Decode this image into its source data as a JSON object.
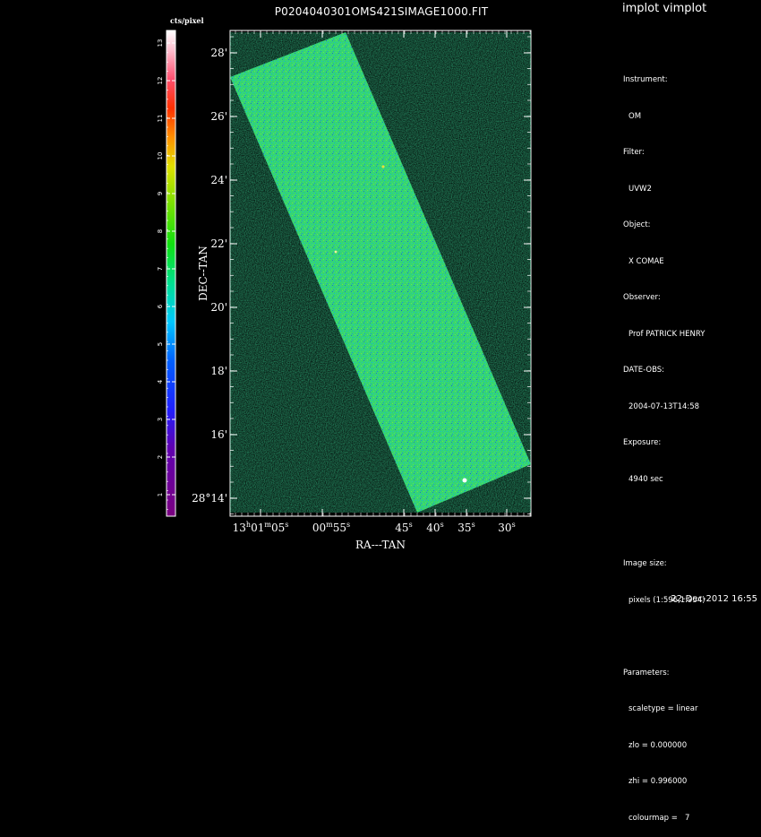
{
  "header": {
    "app_title": "implot vimplot",
    "image_title": "P0204040301OMS421SIMAGE1000.FIT"
  },
  "colorbar": {
    "unit_label": "cts/pixel",
    "ticks": [
      "1",
      "2",
      "3",
      "4",
      "5",
      "6",
      "7",
      "8",
      "9",
      "10",
      "11",
      "12",
      "13"
    ]
  },
  "axes": {
    "x_label": "RA---TAN",
    "y_label": "DEC--TAN",
    "x_ticks": [
      {
        "h": "13",
        "m": "01",
        "s": "05",
        "label_full": true
      },
      {
        "m": "00",
        "s": "55",
        "label_mid": true
      },
      {
        "s": "45"
      },
      {
        "s": "40"
      },
      {
        "s": "35"
      },
      {
        "s": "30"
      }
    ],
    "y_ticks": [
      "28'",
      "26'",
      "24'",
      "22'",
      "20'",
      "18'",
      "16'",
      "28°14'"
    ]
  },
  "info": {
    "instrument_label": "Instrument:",
    "instrument_value": "OM",
    "filter_label": "Filter:",
    "filter_value": "UVW2",
    "object_label": "Object:",
    "object_value": "X COMAE",
    "observer_label": "Observer:",
    "observer_value": "Prof PATRICK HENRY",
    "date_label": "DATE-OBS:",
    "date_value": "2004-07-13T14:58",
    "exposure_label": "Exposure:",
    "exposure_value": "4940 sec",
    "image_size_label": "Image size:",
    "image_size_value": "pixels (1:596,1:954)",
    "parameters_label": "Parameters:",
    "scaletype": "scaletype = linear",
    "zlo": "zlo = 0.000000",
    "zhi": "zhi = 0.996000",
    "colourmap": "colourmap =   7"
  },
  "footer": {
    "timestamp": "22-Dec-2012 16:55"
  }
}
